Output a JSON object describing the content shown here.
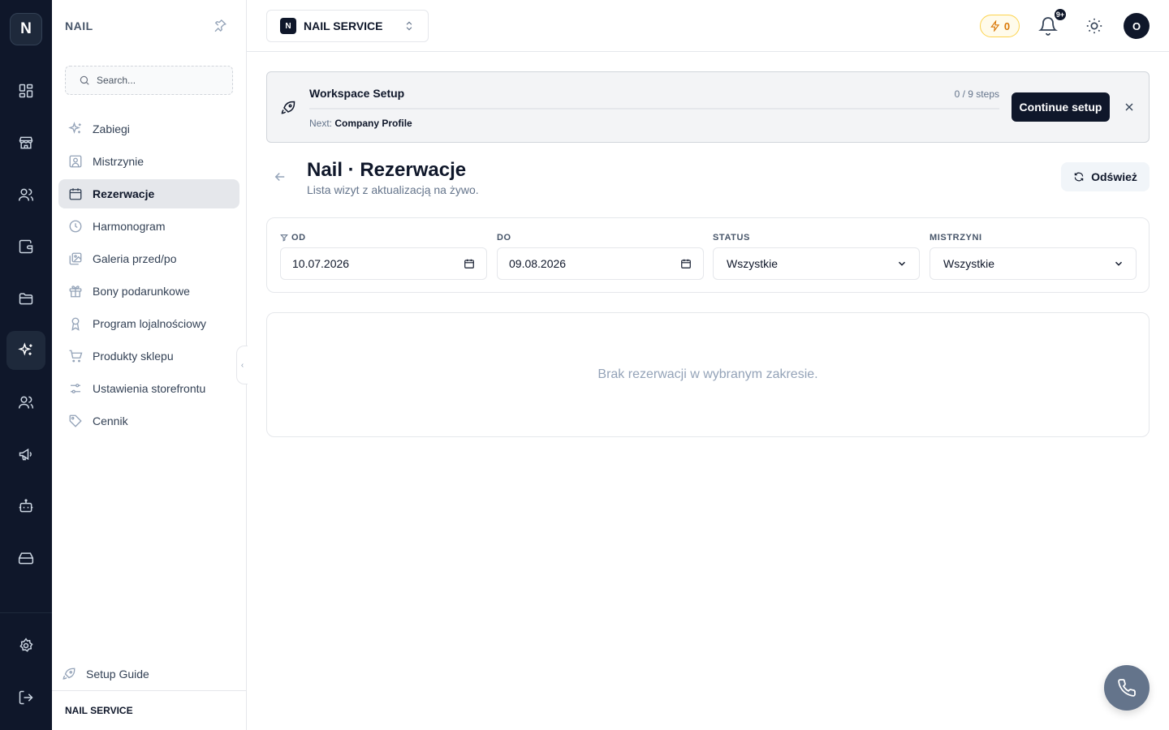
{
  "rail": {
    "logo": "N",
    "items": [
      {
        "icon": "dashboard-icon"
      },
      {
        "icon": "store-icon"
      },
      {
        "icon": "users-icon"
      },
      {
        "icon": "wallet-icon"
      },
      {
        "icon": "folder-icon"
      },
      {
        "icon": "sparkles-icon",
        "active": true
      },
      {
        "icon": "team-icon"
      },
      {
        "icon": "megaphone-icon"
      },
      {
        "icon": "bot-icon"
      },
      {
        "icon": "hard-drive-icon"
      }
    ],
    "bottom": [
      {
        "icon": "settings-icon"
      },
      {
        "icon": "logout-icon"
      }
    ]
  },
  "sidebar": {
    "title": "NAIL",
    "search_placeholder": "Search...",
    "items": [
      {
        "label": "Zabiegi",
        "icon": "sparkles-icon"
      },
      {
        "label": "Mistrzynie",
        "icon": "contact-icon"
      },
      {
        "label": "Rezerwacje",
        "icon": "calendar-icon",
        "active": true
      },
      {
        "label": "Harmonogram",
        "icon": "clock-icon"
      },
      {
        "label": "Galeria przed/po",
        "icon": "images-icon"
      },
      {
        "label": "Bony podarunkowe",
        "icon": "gift-icon"
      },
      {
        "label": "Program lojalnościowy",
        "icon": "award-icon"
      },
      {
        "label": "Produkty sklepu",
        "icon": "cart-icon"
      },
      {
        "label": "Ustawienia storefrontu",
        "icon": "sliders-icon"
      },
      {
        "label": "Cennik",
        "icon": "tag-icon"
      }
    ],
    "setup_guide": "Setup Guide",
    "footer": "NAIL SERVICE"
  },
  "topbar": {
    "workspace_badge": "N",
    "workspace_name": "NAIL SERVICE",
    "credits": "0",
    "notifications_badge": "9+",
    "avatar": "O"
  },
  "banner": {
    "title": "Workspace Setup",
    "next_label": "Next:",
    "next_value": "Company Profile",
    "steps": "0 / 9 steps",
    "progress": 0,
    "button": "Continue setup"
  },
  "page": {
    "title": "Nail · Rezerwacje",
    "subtitle": "Lista wizyt z aktualizacją na żywo.",
    "refresh": "Odśwież"
  },
  "filters": {
    "od_label": "OD",
    "od_value": "10.07.2026",
    "do_label": "DO",
    "do_value": "09.08.2026",
    "status_label": "STATUS",
    "status_value": "Wszystkie",
    "mistrzyni_label": "MISTRZYNI",
    "mistrzyni_value": "Wszystkie"
  },
  "empty_message": "Brak rezerwacji w wybranym zakresie.",
  "colors": {
    "rail_bg": "#0f172a",
    "accent": "#0f172a",
    "credits": "#d97706",
    "fab": "#64748b"
  }
}
